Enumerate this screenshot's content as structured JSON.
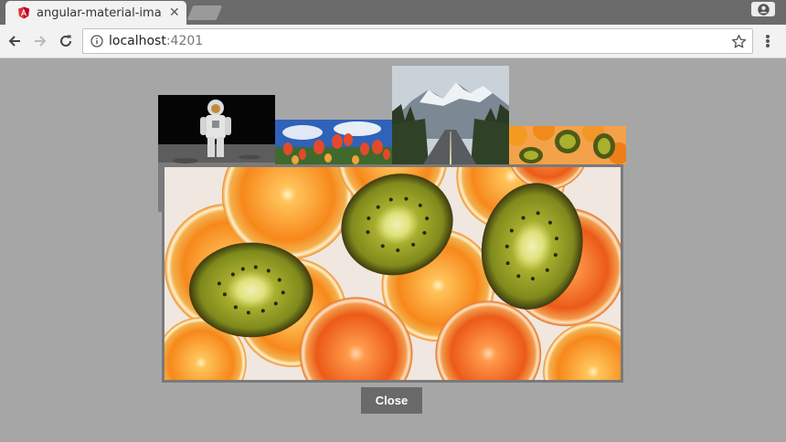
{
  "browser": {
    "tab": {
      "title": "angular-material-image",
      "favicon": "angular-shield-icon",
      "close_glyph": "✕"
    },
    "address": {
      "host": "localhost",
      "port": ":4201"
    },
    "icons": [
      "back-arrow-icon",
      "forward-arrow-icon",
      "reload-icon",
      "info-icon",
      "star-icon",
      "menu-dots-icon",
      "account-icon"
    ]
  },
  "gallery": {
    "thumbnails": [
      {
        "subject": "astronaut on moon"
      },
      {
        "subject": "red tulips under blue sky"
      },
      {
        "subject": "mountain road"
      },
      {
        "subject": "oranges and kiwis"
      }
    ],
    "dialog": {
      "subject": "sliced oranges and kiwis",
      "close_label": "Close"
    }
  },
  "colors": {
    "page_background": "#a6a6a6",
    "close_button": "#6a6a6a",
    "tabstrip": "#6b6b6b",
    "angular_red": "#dd3333"
  }
}
